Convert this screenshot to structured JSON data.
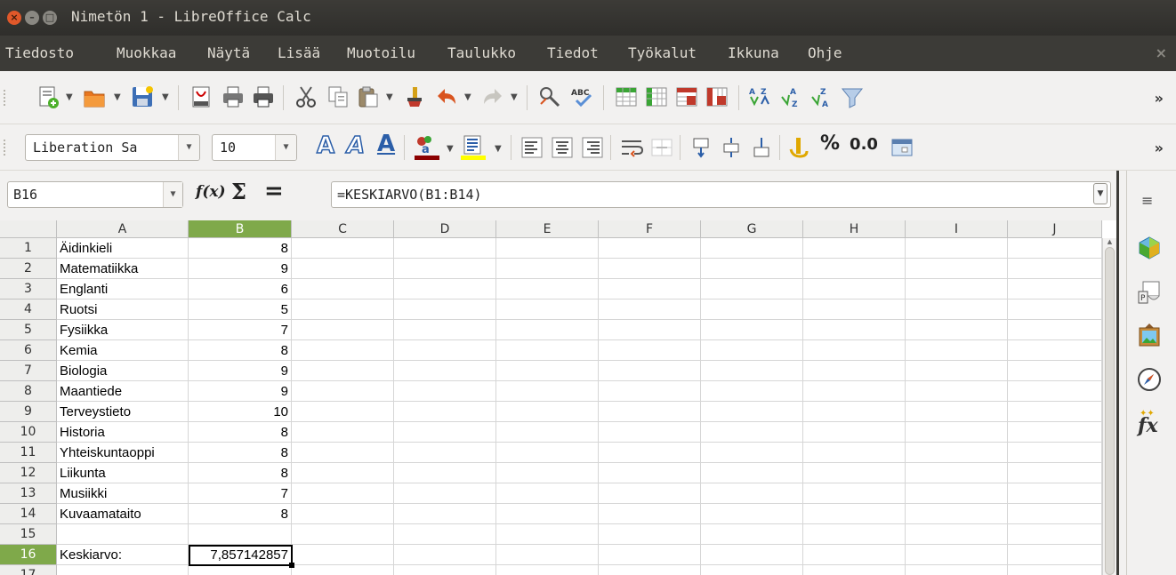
{
  "window": {
    "title": "Nimetön 1 - LibreOffice Calc",
    "close_glyph": "×",
    "minimize_glyph": "–",
    "maximize_glyph": "□"
  },
  "menubar": {
    "items": [
      "Tiedosto",
      "Muokkaa",
      "Näytä",
      "Lisää",
      "Muotoilu",
      "Taulukko",
      "Tiedot",
      "Työkalut",
      "Ikkuna",
      "Ohje"
    ],
    "close_glyph": "×"
  },
  "toolbar1": {
    "icons": [
      "new-document-icon",
      "open-icon",
      "save-icon",
      "export-pdf-icon",
      "print-icon",
      "print-preview-icon",
      "cut-icon",
      "copy-icon",
      "paste-icon",
      "clone-formatting-icon",
      "undo-icon",
      "redo-icon",
      "find-replace-icon",
      "spellcheck-icon",
      "row-icon",
      "column-icon",
      "delete-row-icon",
      "delete-column-icon",
      "sort-icon",
      "sort-ascending-icon",
      "sort-descending-icon",
      "autofilter-icon"
    ],
    "overflow_glyph": "»"
  },
  "toolbar2": {
    "font_name": "Liberation Sa",
    "font_size": "10",
    "bold_glyph": "A",
    "italic_glyph": "A",
    "underline_glyph": "A",
    "percent_glyph": "%",
    "decimal_glyph": "0.0",
    "overflow_glyph": "»",
    "highlight_color": "#8b0000",
    "font_color": "#ffff00"
  },
  "formulabar": {
    "cell_reference": "B16",
    "fx_label": "f(x)",
    "sum_glyph": "Σ",
    "equals_glyph": "=",
    "formula": "=KESKIARVO(B1:B14)"
  },
  "sheet": {
    "columns": [
      "A",
      "B",
      "C",
      "D",
      "E",
      "F",
      "G",
      "H",
      "I",
      "J"
    ],
    "active_column": "B",
    "active_row": 16,
    "rows": [
      {
        "n": "1",
        "a": "Äidinkieli",
        "b": "8"
      },
      {
        "n": "2",
        "a": "Matematiikka",
        "b": "9"
      },
      {
        "n": "3",
        "a": "Englanti",
        "b": "6"
      },
      {
        "n": "4",
        "a": "Ruotsi",
        "b": "5"
      },
      {
        "n": "5",
        "a": "Fysiikka",
        "b": "7"
      },
      {
        "n": "6",
        "a": "Kemia",
        "b": "8"
      },
      {
        "n": "7",
        "a": "Biologia",
        "b": "9"
      },
      {
        "n": "8",
        "a": "Maantiede",
        "b": "9"
      },
      {
        "n": "9",
        "a": "Terveystieto",
        "b": "10"
      },
      {
        "n": "10",
        "a": "Historia",
        "b": "8"
      },
      {
        "n": "11",
        "a": "Yhteiskuntaoppi",
        "b": "8"
      },
      {
        "n": "12",
        "a": "Liikunta",
        "b": "8"
      },
      {
        "n": "13",
        "a": "Musiikki",
        "b": "7"
      },
      {
        "n": "14",
        "a": "Kuvaamataito",
        "b": "8"
      },
      {
        "n": "15",
        "a": "",
        "b": ""
      },
      {
        "n": "16",
        "a": "Keskiarvo:",
        "b": "7,857142857"
      },
      {
        "n": "17",
        "a": "",
        "b": ""
      }
    ]
  },
  "sidebar": {
    "menu_glyph": "≡",
    "icons": [
      "properties-icon",
      "styles-icon",
      "gallery-icon",
      "navigator-icon",
      "functions-icon"
    ],
    "functions_glyph": "fx"
  }
}
